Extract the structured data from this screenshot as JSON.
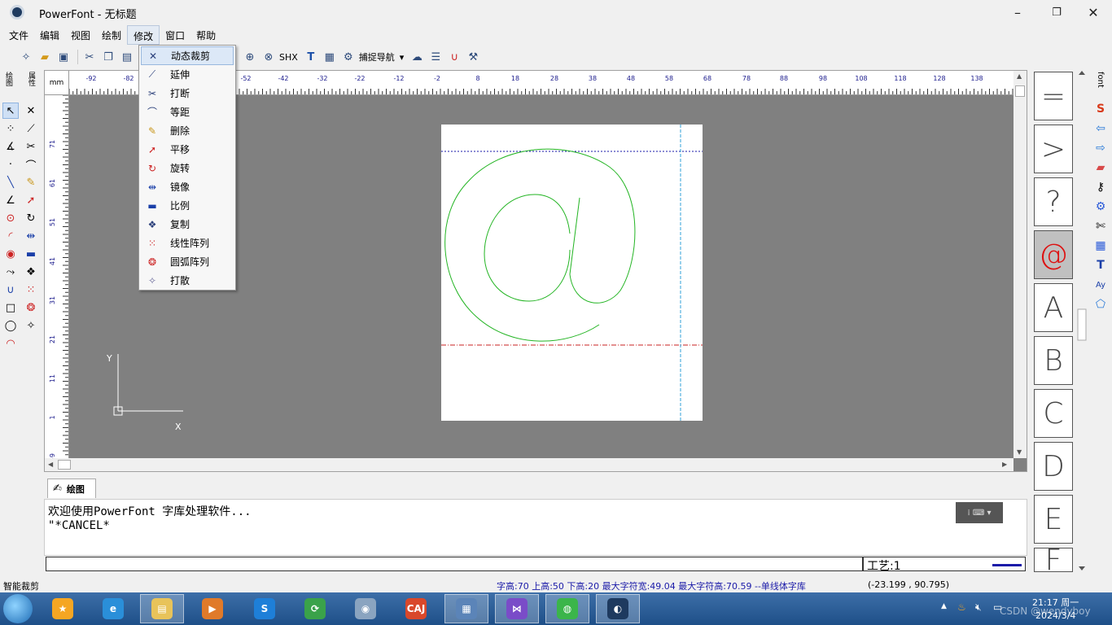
{
  "window": {
    "title": "PowerFont - 无标题",
    "min_glyph": "–",
    "max_glyph": "❐",
    "close_glyph": "✕"
  },
  "menubar": [
    "文件",
    "编辑",
    "视图",
    "绘制",
    "修改",
    "窗口",
    "帮助"
  ],
  "menubar_active": "修改",
  "toolbar": {
    "shx_label": "SHX",
    "snap_nav_label": "捕捉导航"
  },
  "left_tabs": [
    "绘图",
    "属性"
  ],
  "ruler": {
    "unit_label": "mm",
    "h_ticks": [
      "-92",
      "-82",
      "-52",
      "-42",
      "-32",
      "-22",
      "-12",
      "-2",
      "8",
      "18",
      "28",
      "38",
      "48",
      "58",
      "68",
      "78",
      "88",
      "98",
      "108",
      "118",
      "128",
      "138"
    ],
    "v_ticks": [
      "71",
      "61",
      "51",
      "41",
      "31",
      "21",
      "11",
      "1",
      "-9"
    ]
  },
  "axis": {
    "y_label": "Y",
    "x_label": "X"
  },
  "modify_menu": {
    "items": [
      {
        "label": "动态裁剪",
        "icon": "dynamic-trim-icon"
      },
      {
        "label": "延伸",
        "icon": "extend-icon"
      },
      {
        "label": "打断",
        "icon": "break-icon"
      },
      {
        "label": "等距",
        "icon": "offset-icon"
      },
      {
        "label": "删除",
        "icon": "erase-icon"
      },
      {
        "label": "平移",
        "icon": "move-icon"
      },
      {
        "label": "旋转",
        "icon": "rotate-icon"
      },
      {
        "label": "镜像",
        "icon": "mirror-icon"
      },
      {
        "label": "比例",
        "icon": "scale-icon"
      },
      {
        "label": "复制",
        "icon": "copy-icon"
      },
      {
        "label": "线性阵列",
        "icon": "linear-array-icon"
      },
      {
        "label": "圆弧阵列",
        "icon": "arc-array-icon"
      },
      {
        "label": "打散",
        "icon": "explode-icon"
      }
    ],
    "highlighted": "动态裁剪"
  },
  "glyphs": [
    "=",
    ">",
    "?",
    "@",
    "A",
    "B",
    "C",
    "D",
    "E",
    "F"
  ],
  "selected_glyph": "@",
  "right_strip": {
    "tab_label": "font"
  },
  "command": {
    "tab_label": "绘图",
    "lines": [
      "欢迎使用PowerFont 字库处理软件...",
      "\"*CANCEL*"
    ],
    "input_value": ""
  },
  "craft_label": "工艺:1",
  "status": {
    "mode": "智能裁剪",
    "font_metrics": "字高:70 上高:50 下高:20 最大字符宽:49.04  最大字符高:70.59  --单线体字库",
    "coords": "(-23.199 , 90.795)"
  },
  "taskbar": {
    "apps": [
      {
        "name": "star-app",
        "color": "#f5a623",
        "glyph": "★"
      },
      {
        "name": "ie-app",
        "color": "#2a8fd9",
        "glyph": "e"
      },
      {
        "name": "explorer-app",
        "color": "#e8c35a",
        "glyph": "▤"
      },
      {
        "name": "media-app",
        "color": "#e07a2a",
        "glyph": "▶"
      },
      {
        "name": "sogou-app",
        "color": "#1e7fd8",
        "glyph": "S"
      },
      {
        "name": "browser-app",
        "color": "#3aa24a",
        "glyph": "⟳"
      },
      {
        "name": "mouse-app",
        "color": "#8aa4c0",
        "glyph": "◉"
      },
      {
        "name": "caj-app",
        "color": "#d9482b",
        "glyph": "CAJ"
      },
      {
        "name": "desktop-app",
        "color": "#5b84b8",
        "glyph": "▦"
      },
      {
        "name": "vs-app",
        "color": "#7a4cc8",
        "glyph": "⋈"
      },
      {
        "name": "wechat-app",
        "color": "#3bb54a",
        "glyph": "◍"
      },
      {
        "name": "powerfont-app",
        "color": "#1e3a5f",
        "glyph": "◐"
      }
    ],
    "clock_time": "21:17 周一",
    "clock_date": "2024/3/4",
    "watermark": "CSDN @wendyboy"
  }
}
